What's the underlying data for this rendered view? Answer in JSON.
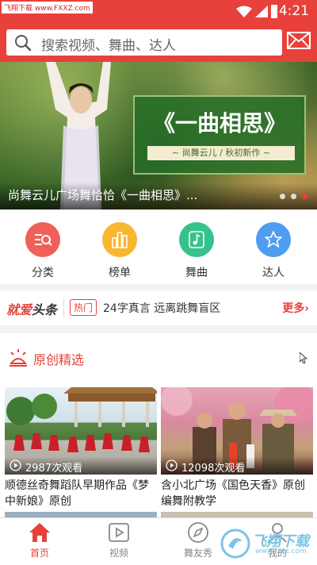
{
  "status_bar": {
    "watermark": "飞翔下载 www.FXXZ.com",
    "time": "4:21"
  },
  "header": {
    "search_placeholder": "搜索视频、舞曲、达人"
  },
  "banner": {
    "card_title": "《一曲相思》",
    "card_subtitle": "~ 尚舞云儿 / 秋初新作 ~",
    "caption": "尚舞云儿广场舞恰恰《一曲相思》...",
    "slide_count": 3,
    "active_slide": 3
  },
  "categories": [
    {
      "label": "分类",
      "icon": "category-icon",
      "color": "#f0605a"
    },
    {
      "label": "榜单",
      "icon": "ranking-icon",
      "color": "#f7b731"
    },
    {
      "label": "舞曲",
      "icon": "music-note-icon",
      "color": "#35c28b"
    },
    {
      "label": "达人",
      "icon": "star-icon",
      "color": "#4f9df0"
    }
  ],
  "headline": {
    "brand_a": "就爱",
    "brand_b": "头条",
    "tag": "热门",
    "text": "24字真言 远离跳舞盲区",
    "more": "更多›"
  },
  "section": {
    "title": "原创精选"
  },
  "videos": [
    {
      "views": "2987次观看",
      "title": "顺德丝奇舞蹈队早期作品《梦中新娘》原创"
    },
    {
      "views": "12098次观看",
      "title": "含小北广场《国色天香》原创编舞附教学"
    }
  ],
  "nav": [
    {
      "label": "首页",
      "icon": "home-icon",
      "active": true
    },
    {
      "label": "视频",
      "icon": "video-icon",
      "active": false
    },
    {
      "label": "舞友秀",
      "icon": "compass-icon",
      "active": false
    },
    {
      "label": "我的",
      "icon": "profile-icon",
      "active": false
    }
  ],
  "site_mark": {
    "name": "飞翔下载",
    "url": "www.fxxz.com"
  },
  "colors": {
    "brand": "#e8413b",
    "text": "#333333",
    "muted": "#888888"
  }
}
